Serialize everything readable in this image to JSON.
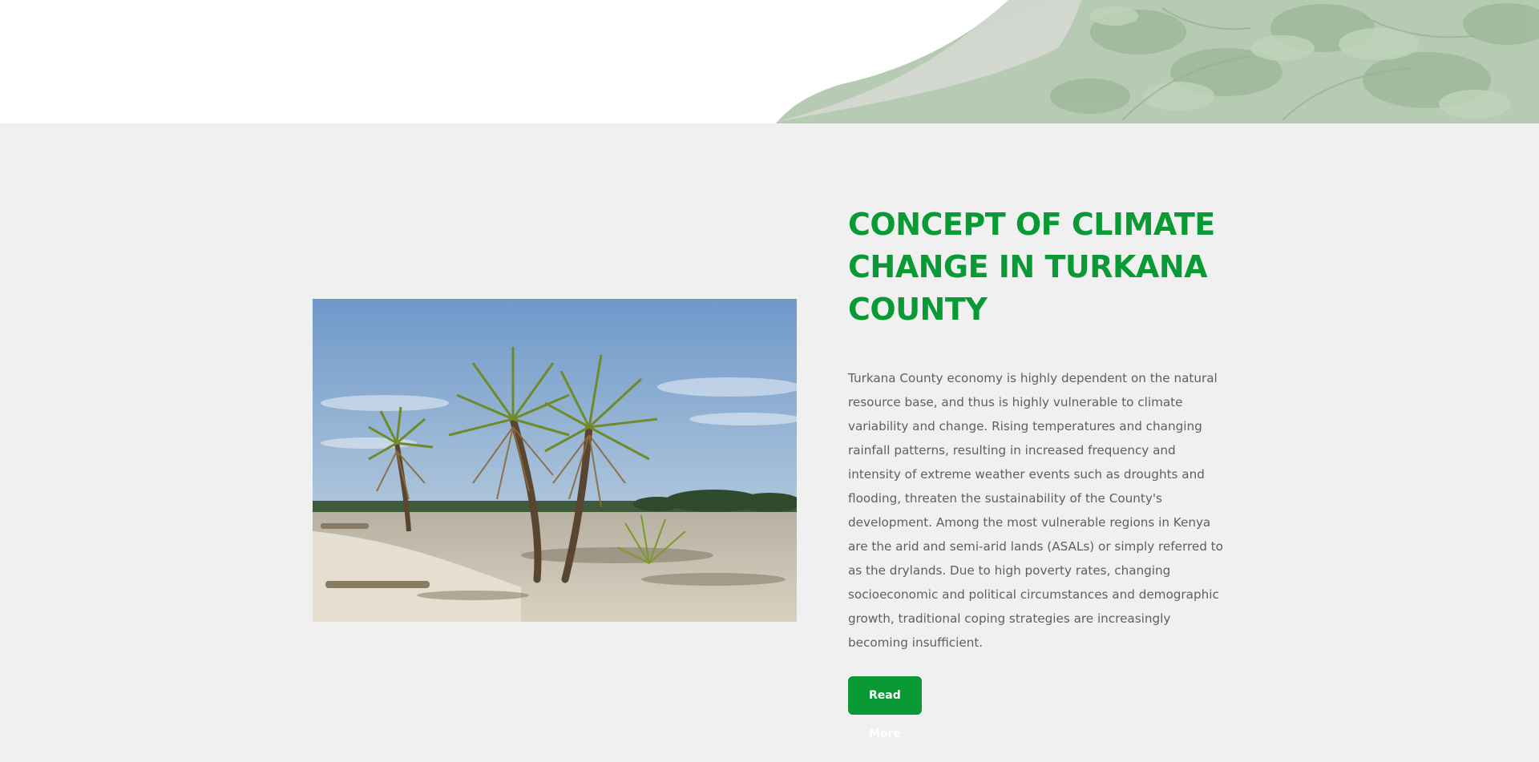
{
  "section": {
    "title": "CONCEPT OF CLIMATE CHANGE IN TURKANA COUNTY",
    "body": "Turkana County economy is highly dependent on the natural resource base, and thus is highly vulnerable to climate variability and change. Rising temperatures and changing rainfall patterns, resulting in increased frequency and intensity of extreme weather events such as droughts and flooding, threaten the sustainability of the County's development. Among the most vulnerable regions in Kenya are the arid and semi-arid lands (ASALs) or simply referred to as the drylands. Due to high poverty rates, changing socioeconomic and political circumstances and demographic growth, traditional coping strategies are increasingly becoming insufficient.",
    "button_label": "Read More"
  },
  "images": {
    "hero": "fern-forest-banner",
    "photo": "palm-trees-on-beach"
  },
  "colors": {
    "accent": "#0a9a35",
    "background": "#f0f0f0",
    "body_text": "#5f5f5f"
  }
}
